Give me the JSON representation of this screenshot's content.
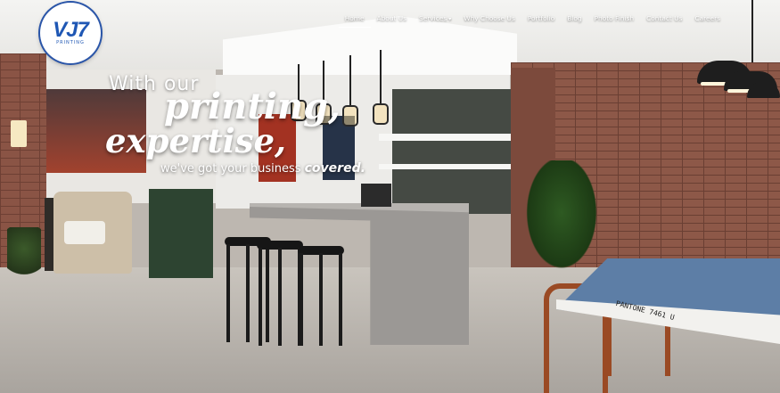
{
  "logo": {
    "mark": "VJ7",
    "sub": "PRINTING"
  },
  "nav": {
    "items": [
      {
        "label": "Home",
        "active": true
      },
      {
        "label": "About Us"
      },
      {
        "label": "Services",
        "dropdown": true
      },
      {
        "label": "Why Choose Us"
      },
      {
        "label": "Portfolio"
      },
      {
        "label": "Blog"
      },
      {
        "label": "Photo Finish"
      },
      {
        "label": "Contact Us"
      },
      {
        "label": "Careers"
      }
    ],
    "caret": "▾"
  },
  "hero": {
    "line1": "With our",
    "line2": "printing,",
    "line3": "expertise,",
    "line4_pre": "we've got your business ",
    "line4_em": "covered."
  },
  "scene": {
    "pantone": "PANTONE 7461 U"
  },
  "colors": {
    "logo_blue": "#1f57b4",
    "brick": "#8d5848",
    "table_blue": "#5d7ea6"
  }
}
